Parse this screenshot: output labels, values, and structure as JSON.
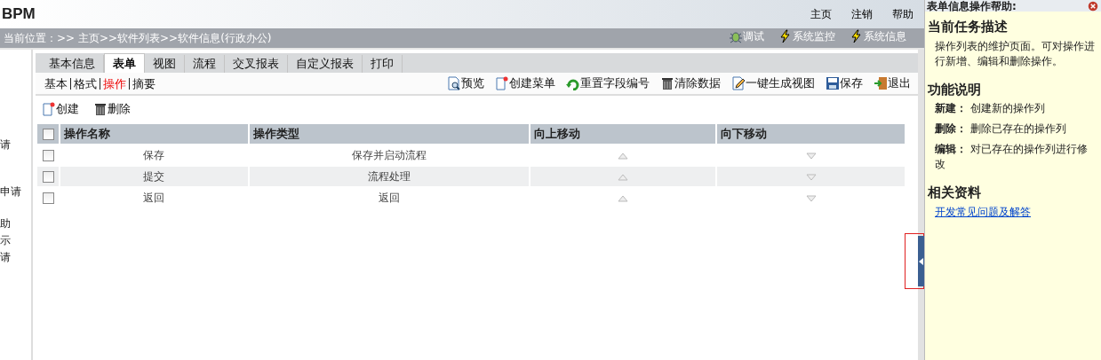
{
  "header": {
    "title": "BPM",
    "links": [
      "主页",
      "注销",
      "帮助"
    ]
  },
  "breadcrumb": {
    "text": "当前位置：>> 主页>>软件列表>>软件信息(行政办公)",
    "tools": [
      {
        "label": "调试",
        "kind": "bug"
      },
      {
        "label": "系统监控",
        "kind": "bolt"
      },
      {
        "label": "系统信息",
        "kind": "bolt"
      }
    ]
  },
  "side_fragments": [
    "请",
    "申请",
    "助",
    "示",
    "请"
  ],
  "tabs": [
    {
      "label": "基本信息",
      "selected": false
    },
    {
      "label": "表单",
      "selected": true
    },
    {
      "label": "视图",
      "selected": false
    },
    {
      "label": "流程",
      "selected": false
    },
    {
      "label": "交叉报表",
      "selected": false
    },
    {
      "label": "自定义报表",
      "selected": false
    },
    {
      "label": "打印",
      "selected": false
    }
  ],
  "subtabs": [
    {
      "label": "基本",
      "selected": false
    },
    {
      "label": "格式",
      "selected": false
    },
    {
      "label": "操作",
      "selected": true
    },
    {
      "label": "摘要",
      "selected": false
    }
  ],
  "toolbar": [
    {
      "label": "预览",
      "kind": "preview"
    },
    {
      "label": "创建菜单",
      "kind": "new"
    },
    {
      "label": "重置字段编号",
      "kind": "reset"
    },
    {
      "label": "清除数据",
      "kind": "trash"
    },
    {
      "label": "一键生成视图",
      "kind": "edit"
    },
    {
      "label": "保存",
      "kind": "save"
    },
    {
      "label": "退出",
      "kind": "exit"
    }
  ],
  "actions": [
    {
      "label": "创建",
      "kind": "new"
    },
    {
      "label": "删除",
      "kind": "trash"
    }
  ],
  "table": {
    "columns": [
      "操作名称",
      "操作类型",
      "向上移动",
      "向下移动"
    ],
    "header_checked": false,
    "rows": [
      {
        "checked": false,
        "cells": [
          "保存",
          "保存并启动流程"
        ]
      },
      {
        "checked": false,
        "cells": [
          "提交",
          "流程处理"
        ]
      },
      {
        "checked": false,
        "cells": [
          "返回",
          "返回"
        ]
      }
    ]
  },
  "help": {
    "title": "表单信息操作帮助:",
    "sections": [
      {
        "heading": "当前任务描述",
        "items": [
          {
            "kind": "text",
            "text": "操作列表的维护页面。可对操作进行新增、编辑和删除操作。"
          }
        ]
      },
      {
        "heading": "功能说明",
        "items": [
          {
            "kind": "def",
            "term": "新建：",
            "text": "创建新的操作列"
          },
          {
            "kind": "def",
            "term": "删除：",
            "text": "删除已存在的操作列"
          },
          {
            "kind": "def",
            "term": "编辑：",
            "text": "对已存在的操作列进行修改"
          }
        ]
      },
      {
        "heading": "相关资料",
        "items": [
          {
            "kind": "link",
            "text": "开发常见问题及解答"
          }
        ]
      }
    ]
  }
}
